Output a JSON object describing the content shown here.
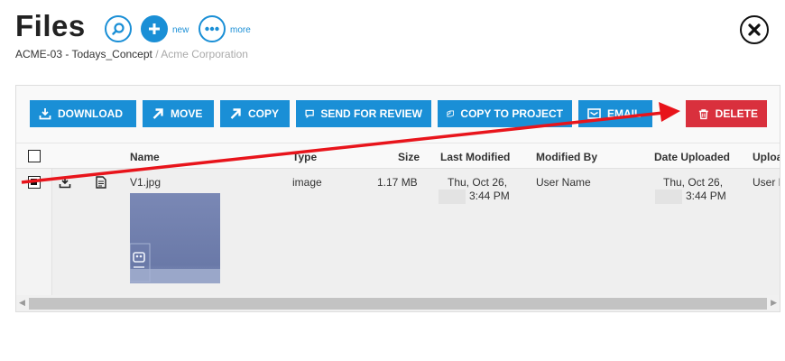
{
  "header": {
    "title": "Files",
    "search_label": "",
    "new_label": "new",
    "more_label": "more"
  },
  "breadcrumb": {
    "project": "ACME-03 - Todays_Concept",
    "separator": " / ",
    "organization": "Acme Corporation"
  },
  "toolbar": {
    "download": "DOWNLOAD",
    "move": "MOVE",
    "copy": "COPY",
    "send_for_review": "SEND FOR REVIEW",
    "copy_to_project": "COPY TO PROJECT",
    "email": "EMAIL",
    "delete": "DELETE"
  },
  "table": {
    "columns": {
      "name": "Name",
      "type": "Type",
      "size": "Size",
      "last_modified": "Last Modified",
      "modified_by": "Modified By",
      "date_uploaded": "Date Uploaded",
      "uploaded_by": "Uploa"
    },
    "rows": [
      {
        "selected": true,
        "name": "V1.jpg",
        "type": "image",
        "size": "1.17 MB",
        "modified_date": "Thu, Oct 26,",
        "modified_time": "3:44 PM",
        "modified_by": "User Name",
        "uploaded_date": "Thu, Oct 26,",
        "uploaded_time": "3:44 PM",
        "uploaded_by": "User N"
      }
    ]
  },
  "colors": {
    "accent": "#1a8fd6",
    "danger": "#d9303d",
    "annotation_arrow": "#e8141b"
  }
}
